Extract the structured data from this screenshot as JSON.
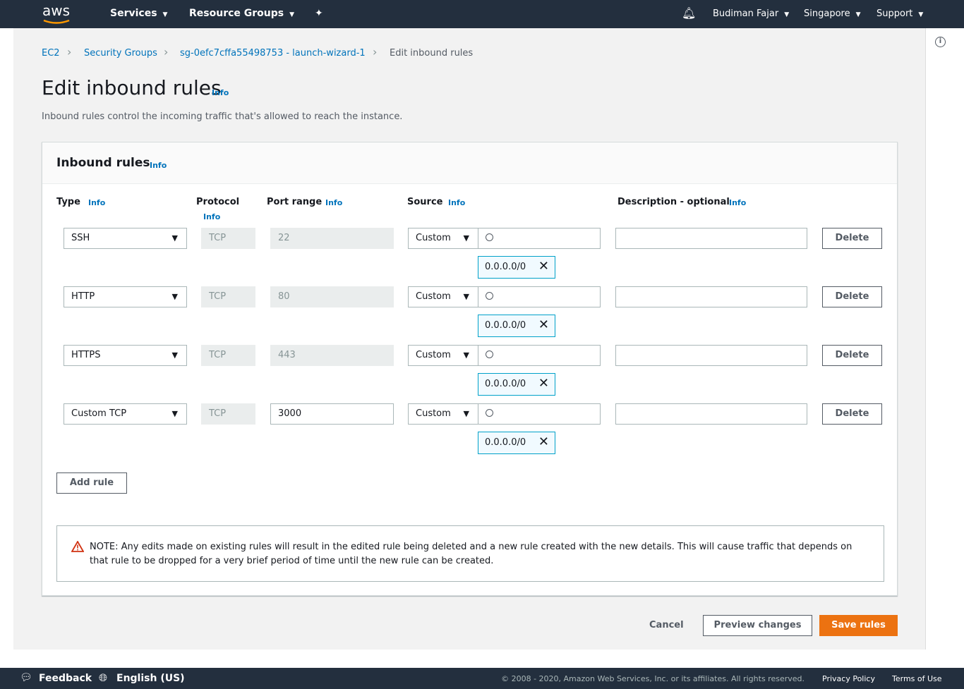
{
  "nav": {
    "logo": "aws",
    "services": "Services",
    "resource_groups": "Resource Groups",
    "user": "Budiman Fajar",
    "region": "Singapore",
    "support": "Support"
  },
  "breadcrumb": [
    "EC2",
    "Security Groups",
    "sg-0efc7cffa55498753 - launch-wizard-1",
    "Edit inbound rules"
  ],
  "page": {
    "title": "Edit inbound rules",
    "info": "Info",
    "description": "Inbound rules control the incoming traffic that's allowed to reach the instance."
  },
  "card": {
    "title": "Inbound rules",
    "info": "Info",
    "columns": {
      "type": "Type",
      "protocol": "Protocol",
      "port": "Port range",
      "source": "Source",
      "description": "Description - optional",
      "info": "Info"
    },
    "rules": [
      {
        "type": "SSH",
        "protocol": "TCP",
        "port": "22",
        "port_editable": false,
        "source": "Custom",
        "search": "",
        "cidr": "0.0.0.0/0",
        "description": "",
        "delete": "Delete"
      },
      {
        "type": "HTTP",
        "protocol": "TCP",
        "port": "80",
        "port_editable": false,
        "source": "Custom",
        "search": "",
        "cidr": "0.0.0.0/0",
        "description": "",
        "delete": "Delete"
      },
      {
        "type": "HTTPS",
        "protocol": "TCP",
        "port": "443",
        "port_editable": false,
        "source": "Custom",
        "search": "",
        "cidr": "0.0.0.0/0",
        "description": "",
        "delete": "Delete"
      },
      {
        "type": "Custom TCP",
        "protocol": "TCP",
        "port": "3000",
        "port_editable": true,
        "source": "Custom",
        "search": "",
        "cidr": "0.0.0.0/0",
        "description": "",
        "delete": "Delete"
      }
    ],
    "add_rule": "Add rule",
    "note": "NOTE: Any edits made on existing rules will result in the edited rule being deleted and a new rule created with the new details. This will cause traffic that depends on that rule to be dropped for a very brief period of time until the new rule can be created."
  },
  "actions": {
    "cancel": "Cancel",
    "preview": "Preview changes",
    "save": "Save rules"
  },
  "footer": {
    "feedback": "Feedback",
    "language": "English (US)",
    "copyright": "© 2008 - 2020, Amazon Web Services, Inc. or its affiliates. All rights reserved.",
    "privacy": "Privacy Policy",
    "terms": "Terms of Use"
  },
  "colors": {
    "nav": "#232f3e",
    "link": "#0073bb",
    "primary": "#ec7211"
  }
}
